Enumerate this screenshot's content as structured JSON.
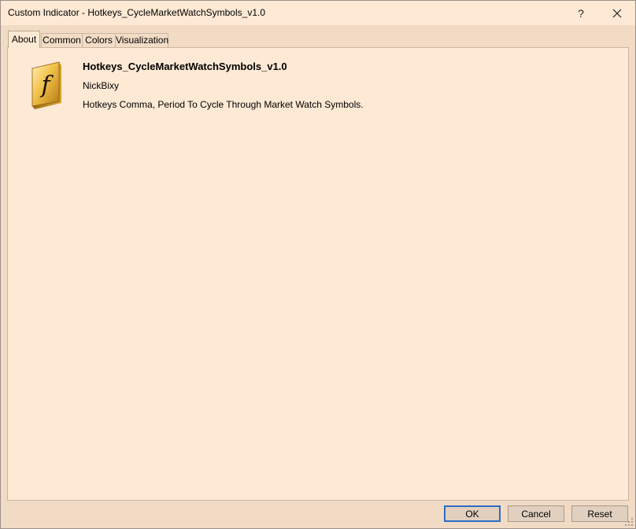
{
  "window": {
    "title": "Custom Indicator - Hotkeys_CycleMarketWatchSymbols_v1.0",
    "help_label": "?",
    "close_icon": "close-icon"
  },
  "tabs": [
    {
      "label": "About",
      "active": true
    },
    {
      "label": "Common",
      "active": false
    },
    {
      "label": "Colors",
      "active": false
    },
    {
      "label": "Visualization",
      "active": false
    }
  ],
  "about": {
    "icon": "function-f-icon",
    "name": "Hotkeys_CycleMarketWatchSymbols_v1.0",
    "author": "NickBixy",
    "description": "Hotkeys Comma, Period To Cycle Through Market Watch Symbols."
  },
  "buttons": {
    "ok": "OK",
    "cancel": "Cancel",
    "reset": "Reset"
  },
  "colors": {
    "dialog_bg": "#f1dbc5",
    "panel_bg": "#fde9d4",
    "default_button_border": "#2b6cc4",
    "icon_gold": "#e8b53c"
  }
}
